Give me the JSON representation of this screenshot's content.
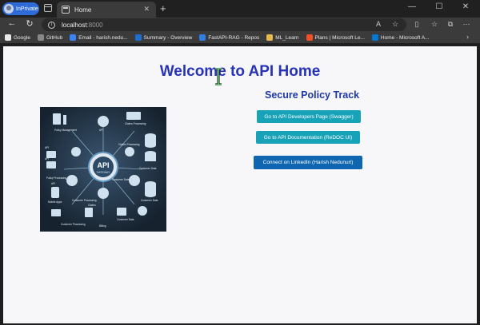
{
  "browser": {
    "inprivate_label": "InPrivate",
    "tab_title": "Home",
    "url_host": "localhost",
    "url_port": ":8000",
    "bookmarks": [
      {
        "label": "Google",
        "color": "#e8e8e8"
      },
      {
        "label": "GitHub",
        "color": "#888888"
      },
      {
        "label": "Email - harish.nedu...",
        "color": "#3b82f6"
      },
      {
        "label": "Summary - Overview",
        "color": "#1c6fd1"
      },
      {
        "label": "FastAPI-RAG - Repos",
        "color": "#2f7de1"
      },
      {
        "label": "ML_Learn",
        "color": "#e8b94b"
      },
      {
        "label": "Plans | Microsoft Le...",
        "color": "#f25022"
      },
      {
        "label": "Home - Microsoft A...",
        "color": "#0078d4"
      }
    ]
  },
  "page": {
    "title": "Welcome to API Home",
    "subtitle": "Secure Policy Track",
    "buttons": {
      "swagger": "Go to API Developers Page (Swagger)",
      "redoc": "Go to API Documentation (ReDOC UI)",
      "linkedin": "Connect on LinkedIn (Harish Nedunuri)"
    },
    "illustration": {
      "center_title": "API",
      "center_sub": "GATEWAY",
      "labels": [
        "Policy Management",
        "API",
        "Claims Processing",
        "Claims Processing",
        "API",
        "API",
        "Policy Processing",
        "Customer Data",
        "Customer Data",
        "API",
        "Mobile Apps",
        "Customer Data",
        "Customer Processing",
        "Billing",
        "Customer Data",
        "Claims",
        "Customer Processing"
      ]
    }
  },
  "colors": {
    "title": "#2633b5",
    "subtitle": "#1e39a5",
    "teal_button": "#17a2b8",
    "blue_button": "#0f66b0"
  },
  "icons": [
    "inprivate-avatar-icon",
    "tab-actions-icon",
    "home-tab-favicon",
    "close-icon",
    "plus-icon",
    "minimize-icon",
    "maximize-icon",
    "close-window-icon",
    "back-arrow-icon",
    "refresh-icon",
    "info-icon",
    "read-aloud-icon",
    "favorite-star-icon",
    "split-screen-icon",
    "favorites-icon",
    "collections-icon",
    "more-icon",
    "chevron-right-icon",
    "text-cursor-icon"
  ]
}
